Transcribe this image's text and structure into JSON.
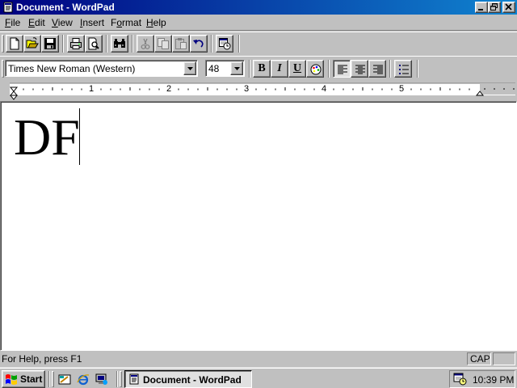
{
  "window": {
    "title": "Document - WordPad",
    "app_icon": "wordpad-document-icon",
    "controls": [
      "minimize-icon",
      "restore-icon",
      "close-icon"
    ]
  },
  "menu": [
    {
      "label": "File",
      "accel": "F",
      "rest": "ile"
    },
    {
      "label": "Edit",
      "accel": "E",
      "rest": "dit"
    },
    {
      "label": "View",
      "accel": "V",
      "rest": "iew"
    },
    {
      "label": "Insert",
      "accel": "I",
      "rest": "nsert"
    },
    {
      "label": "Format",
      "accel": "o",
      "pre": "F",
      "rest": "rmat"
    },
    {
      "label": "Help",
      "accel": "H",
      "rest": "elp"
    }
  ],
  "toolbar": {
    "buttons": [
      "new-icon",
      "open-icon",
      "save-icon",
      "print-icon",
      "print-preview-icon",
      "find-icon",
      "cut-icon",
      "copy-icon",
      "paste-icon",
      "undo-icon",
      "insert-datetime-icon"
    ]
  },
  "format": {
    "font": "Times New Roman (Western)",
    "size": "48",
    "bold": "B",
    "italic": "I",
    "underline": "U",
    "buttons": [
      "bold-icon",
      "italic-icon",
      "underline-icon",
      "color-icon",
      "align-left-icon",
      "align-center-icon",
      "align-right-icon",
      "bullets-icon"
    ]
  },
  "ruler": {
    "numbers": [
      "1",
      "2",
      "3",
      "4",
      "5"
    ]
  },
  "document": {
    "text": "DF"
  },
  "status": {
    "help": "For Help, press F1",
    "cap": "CAP"
  },
  "taskbar": {
    "start": "Start",
    "quick_launch": [
      "show-desktop-icon",
      "internet-explorer-icon",
      "channels-icon"
    ],
    "task": "Document - WordPad",
    "clock": "10:39 PM",
    "tray_icon": "scheduler-icon"
  },
  "colors": {
    "titlebar_start": "#000080",
    "titlebar_end": "#1084d0",
    "face": "#c0c0c0",
    "document_bg": "#ffffff"
  }
}
